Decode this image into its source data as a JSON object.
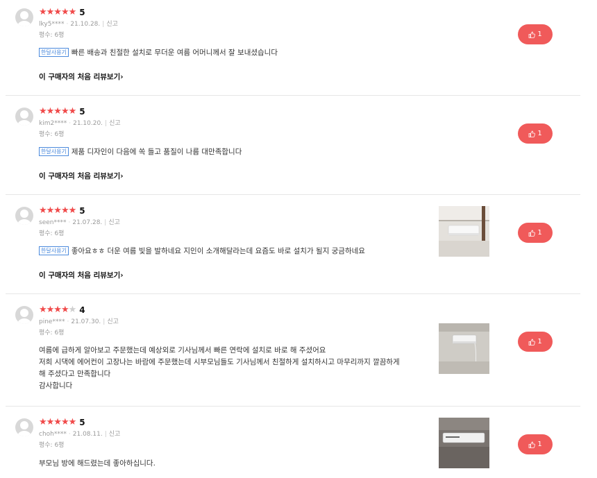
{
  "common": {
    "first_review_link": "이 구매자의 처음 리뷰보기",
    "report_label": "신고",
    "tag_label": "한달사용기",
    "size_label": "평수: 6평",
    "star_empty": "★"
  },
  "reviews": [
    {
      "stars": "★★★★★",
      "stars_empty": "",
      "score": "5",
      "user": "lky5****",
      "date": "21.10.28.",
      "has_tag": true,
      "lines": [
        "빠른 배송과 친절한 설치로 무더운 여름 어머니께서 잘 보내셨습니다"
      ],
      "likes": "1",
      "has_photo": false
    },
    {
      "stars": "★★★★★",
      "stars_empty": "",
      "score": "5",
      "user": "kim2****",
      "date": "21.10.20.",
      "has_tag": true,
      "lines": [
        "제품 디자인이 다음에 쏙 들고 품질이 나름 대만족합니다"
      ],
      "likes": "1",
      "has_photo": false
    },
    {
      "stars": "★★★★★",
      "stars_empty": "",
      "score": "5",
      "user": "seen****",
      "date": "21.07.28.",
      "has_tag": true,
      "lines": [
        "좋아요ㅎㅎ 더운 여름 빛을 발하네요 지인이 소개해달라는데 요즘도 바로 설치가 될지 궁금하네요"
      ],
      "likes": "1",
      "has_photo": true
    },
    {
      "stars": "★★★★",
      "stars_empty": "★",
      "score": "4",
      "user": "pine****",
      "date": "21.07.30.",
      "has_tag": false,
      "lines": [
        "여름에 급하게 알아보고 주문했는데 예상외로 기사님께서 빠른 연락에 설치로 바로 해 주셨어요",
        "저희 시댁에 에어컨이 고장나는 바람에 주문했는데 시부모님들도 기사님께서 친절하게 설치하시고 마무리까지 깔끔하게",
        "해 주셨다고 만족합니다",
        "감사합니다"
      ],
      "likes": "1",
      "has_photo": true
    },
    {
      "stars": "★★★★★",
      "stars_empty": "",
      "score": "5",
      "user": "choh****",
      "date": "21.08.11.",
      "has_tag": false,
      "lines": [
        "부모님 방에 해드렸는데 좋아하십니다."
      ],
      "likes": "1",
      "has_photo": true
    }
  ]
}
